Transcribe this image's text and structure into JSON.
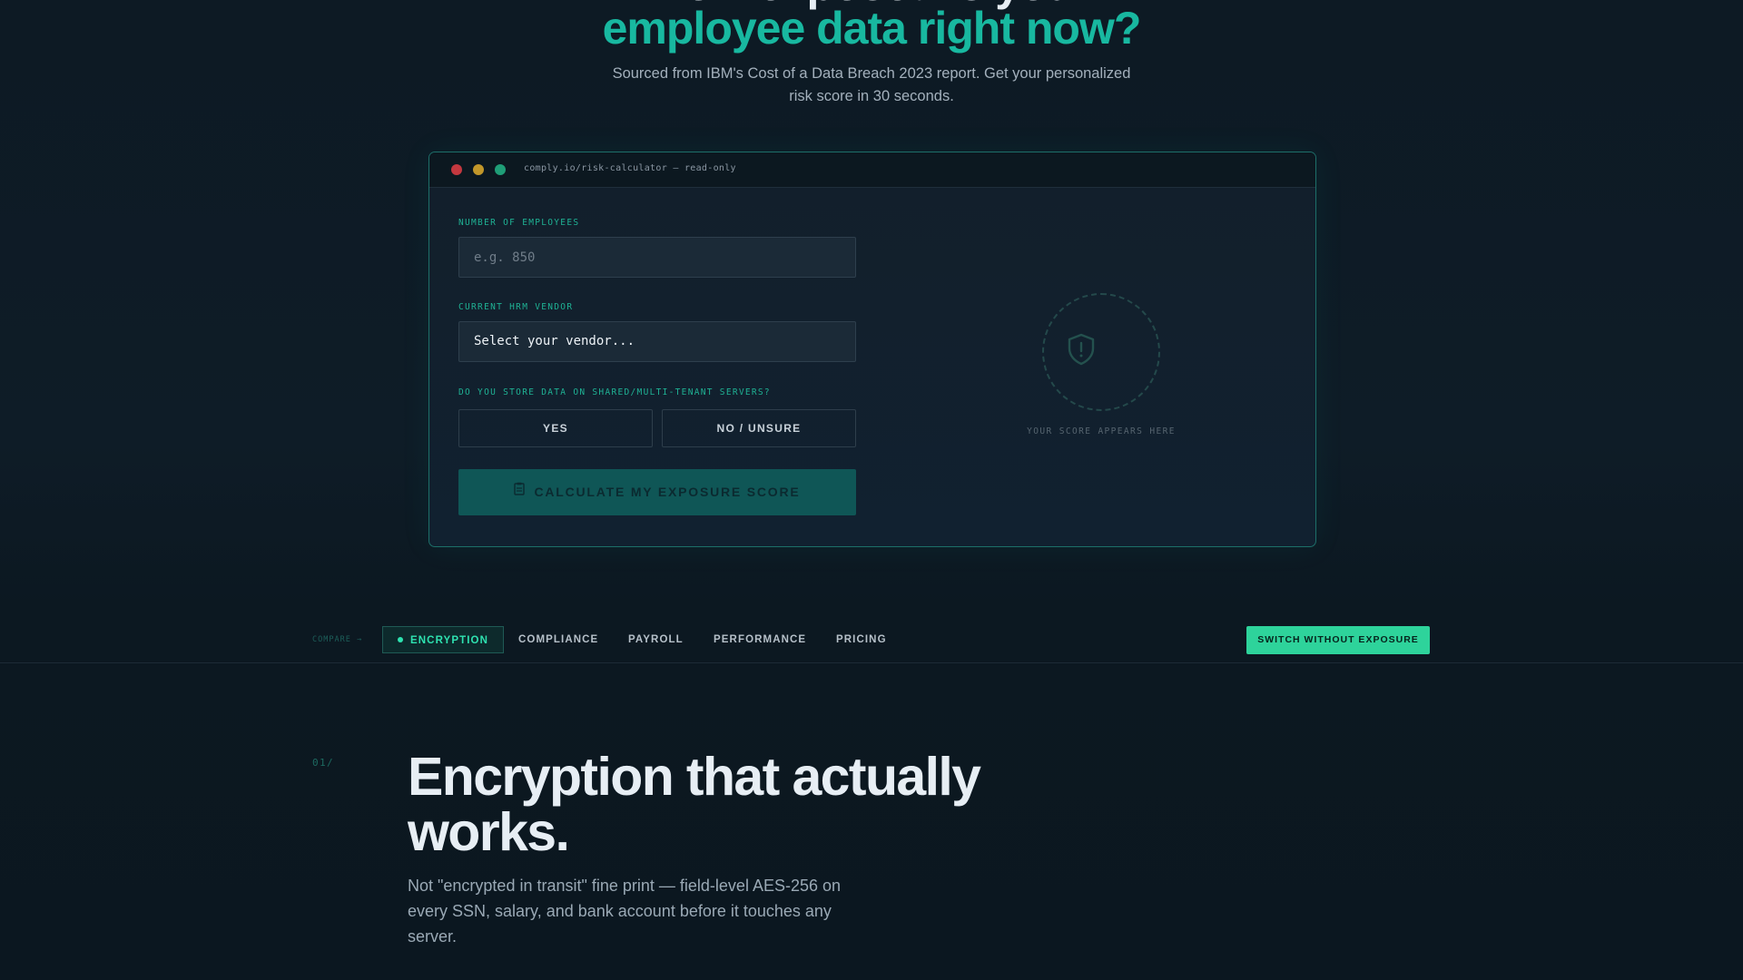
{
  "hero": {
    "partial_heading": "How exposed is your",
    "accent_heading": "employee data right now?",
    "subtitle": "Sourced from IBM's Cost of a Data Breach 2023 report. Get your personalized risk score in 30 seconds."
  },
  "calculator": {
    "window_url": "comply.io/risk-calculator — read-only",
    "employees": {
      "label": "NUMBER OF EMPLOYEES",
      "placeholder": "e.g. 850",
      "value": ""
    },
    "vendor": {
      "label": "CURRENT HRM VENDOR",
      "selected": "Select your vendor..."
    },
    "shared_servers": {
      "label": "DO YOU STORE DATA ON SHARED/MULTI-TENANT SERVERS?",
      "yes_label": "YES",
      "no_label": "NO / UNSURE"
    },
    "submit_label": "CALCULATE MY EXPOSURE SCORE",
    "submit_icon": "clipboard-icon",
    "score_caption": "YOUR SCORE APPEARS HERE",
    "score_icon": "shield-alert-icon"
  },
  "compare_nav": {
    "label": "COMPARE →",
    "tabs": [
      {
        "label": "ENCRYPTION",
        "active": true
      },
      {
        "label": "COMPLIANCE",
        "active": false
      },
      {
        "label": "PAYROLL",
        "active": false
      },
      {
        "label": "PERFORMANCE",
        "active": false
      },
      {
        "label": "PRICING",
        "active": false
      }
    ],
    "cta_label": "SWITCH WITHOUT EXPOSURE"
  },
  "section": {
    "number": "01/",
    "title": "Encryption that actually works.",
    "body": "Not \"encrypted in transit\" fine print — field-level AES-256 on every SSN, salary, and bank account before it touches any server."
  },
  "colors": {
    "accent": "#18b8a0",
    "cta": "#2ed39b",
    "background": "#0d1a24"
  }
}
